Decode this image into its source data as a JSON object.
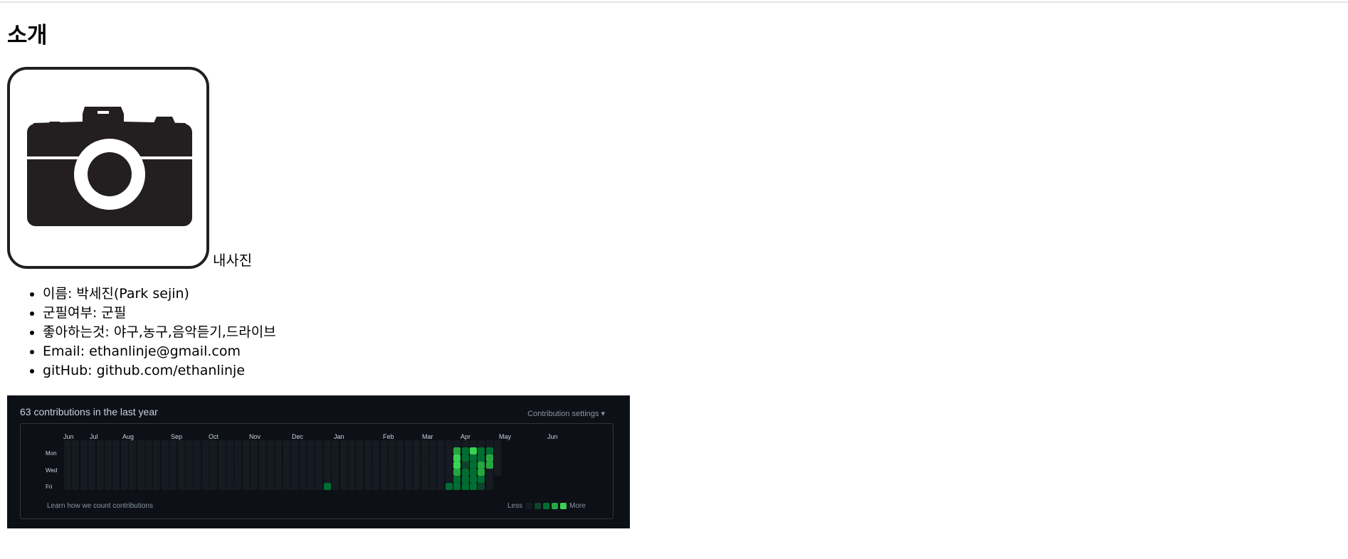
{
  "page": {
    "heading": "소개"
  },
  "photo": {
    "caption": "내사진",
    "icon": "camera-icon"
  },
  "info_items": [
    "이름: 박세진(Park sejin)",
    "군필여부: 군필",
    "좋아하는것: 야구,농구,음악듣기,드라이브",
    "Email: ethanlinje@gmail.com",
    "gitHub: github.com/ethanlinje"
  ],
  "contributions": {
    "title": "63 contributions in the last year",
    "settings_label": "Contribution settings ▾",
    "months": [
      "Jun",
      "Jul",
      "Aug",
      "Sep",
      "Oct",
      "Nov",
      "Dec",
      "Jan",
      "Feb",
      "Mar",
      "Apr",
      "May",
      "Jun"
    ],
    "day_labels": [
      "Mon",
      "Wed",
      "Fri"
    ],
    "footer_link": "Learn how we count contributions",
    "legend_less": "Less",
    "legend_more": "More",
    "colors": [
      "#161b22",
      "#0e4429",
      "#006d32",
      "#26a641",
      "#39d353"
    ]
  }
}
